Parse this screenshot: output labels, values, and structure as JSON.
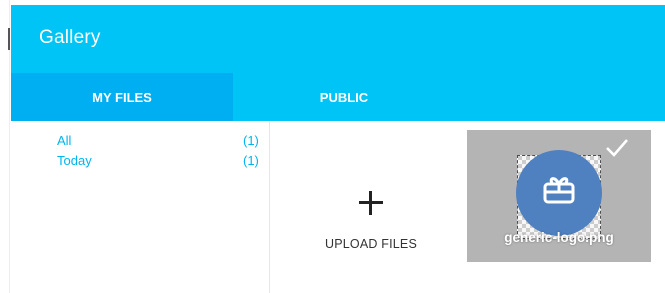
{
  "header": {
    "title": "Gallery"
  },
  "tabs": [
    {
      "label": "MY FILES",
      "active": true
    },
    {
      "label": "PUBLIC",
      "active": false
    }
  ],
  "sidebar": {
    "filters": [
      {
        "label": "All",
        "count": "(1)"
      },
      {
        "label": "Today",
        "count": "(1)"
      }
    ]
  },
  "main": {
    "upload_label": "UPLOAD FILES",
    "files": [
      {
        "name": "generic-logo.png",
        "selected": true,
        "icon": "gift-card-icon"
      }
    ]
  },
  "colors": {
    "header": "#00c3f6",
    "active_tab": "#00aef2",
    "link": "#00b5ee",
    "thumb_bg": "#b4b4b4",
    "logo": "#4f80bf"
  }
}
